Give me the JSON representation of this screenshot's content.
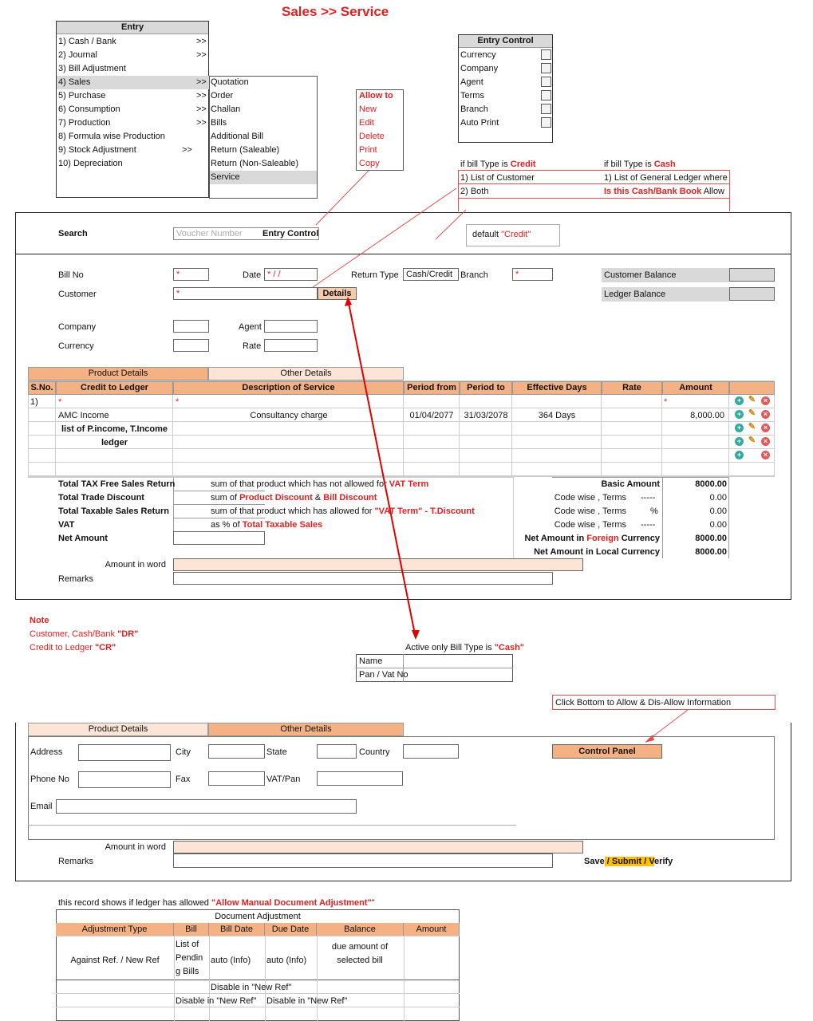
{
  "page_title": "Sales >> Service",
  "entry_menu": {
    "title": "Entry",
    "items": [
      {
        "label": "1) Cash / Bank",
        "arrow": ">>"
      },
      {
        "label": "2) Journal",
        "arrow": ">>"
      },
      {
        "label": "3) Bill Adjustment",
        "arrow": ""
      },
      {
        "label": "4) Sales",
        "arrow": ">>"
      },
      {
        "label": "5) Purchase",
        "arrow": ">>"
      },
      {
        "label": "6) Consumption",
        "arrow": ">>"
      },
      {
        "label": "7) Production",
        "arrow": ">>"
      },
      {
        "label": "8) Formula wise Production",
        "arrow": ""
      },
      {
        "label": "9) Stock Adjustment",
        "arrow": ">>"
      },
      {
        "label": "10) Depreciation",
        "arrow": ""
      }
    ],
    "submenu": [
      "Quotation",
      "Order",
      "Challan",
      "Bills",
      "Additional Bill",
      "Return (Saleable)",
      "Return (Non-Saleable)",
      "Service"
    ]
  },
  "allow_to": {
    "title": "Allow to",
    "items": [
      "New",
      "Edit",
      "Delete",
      "Print",
      "Copy"
    ]
  },
  "entry_control": {
    "title": "Entry Control",
    "items": [
      "Currency",
      "Company",
      "Agent",
      "Terms",
      "Branch",
      "Auto Print"
    ]
  },
  "bill_type_note": {
    "credit_prefix": "if bill Type is ",
    "credit_word": "Credit",
    "credit_items": [
      "1) List of Customer",
      "2) Both"
    ],
    "cash_prefix": "if bill Type is ",
    "cash_word": "Cash",
    "cash_line1": "1) List of General Ledger where",
    "cash_line2_red": "Is this Cash/Bank Book",
    "cash_line2_black": " Allow",
    "default_prefix": "default ",
    "default_value": "\"Credit\""
  },
  "search": {
    "label": "Search",
    "placeholder": "Voucher Number",
    "entry_control": "Entry Control"
  },
  "form": {
    "bill_no": "Bill No",
    "required": "*",
    "date": "Date",
    "date_value": "*  /  /",
    "return_type": "Return Type",
    "return_value": "Cash/Credit",
    "branch": "Branch",
    "customer": "Customer",
    "details": "Details",
    "customer_balance": "Customer Balance",
    "ledger_balance": "Ledger Balance",
    "company": "Company",
    "agent": "Agent",
    "currency": "Currency",
    "rate": "Rate"
  },
  "tabs": {
    "product": "Product Details",
    "other": "Other Details"
  },
  "table": {
    "headers": [
      "S.No.",
      "Credit to Ledger",
      "Description of Service",
      "Period from",
      "Period to",
      "Effective Days",
      "Rate",
      "Amount"
    ],
    "row1": {
      "sno": "1)",
      "ledger": "*",
      "desc": "*",
      "amount": "*"
    },
    "row2": {
      "ledger": "AMC Income",
      "desc": "Consultancy charge",
      "from": "01/04/2077",
      "to": "31/03/2078",
      "days": "364 Days",
      "amount": "8,000.00"
    },
    "row3_line1": "list of P.income, T.Income",
    "row3_line2": "ledger"
  },
  "totals": {
    "tax_free": "Total TAX Free Sales Return",
    "tax_free_note_a": "sum of that product which has not allowed for ",
    "tax_free_note_b": "VAT Term",
    "trade_disc": "Total Trade Discount",
    "trade_note_a": "sum of ",
    "trade_note_b": "Product Discount",
    "trade_note_c": " & ",
    "trade_note_d": "Bill Discount",
    "taxable": "Total Taxable Sales Return",
    "taxable_note_a": "sum of that product which has allowed for ",
    "taxable_note_b": "\"VAT Term\" - T.Discount",
    "vat": "VAT",
    "vat_note_a": "as % of ",
    "vat_note_b": "Total Taxable Sales",
    "net": "Net Amount"
  },
  "summary": {
    "basic": "Basic Amount",
    "basic_val": "8000.00",
    "terms": [
      {
        "label": "Code wise , Terms",
        "sym": "-----",
        "val": "0.00"
      },
      {
        "label": "Code wise , Terms",
        "sym": "%",
        "val": "0.00"
      },
      {
        "label": "Code wise , Terms",
        "sym": "-----",
        "val": "0.00"
      }
    ],
    "net_foreign": "Net Amount in Foreign Currency",
    "net_foreign_val": "8000.00",
    "net_local": "Net Amount in Local Currency",
    "net_local_val": "8000.00"
  },
  "amount_in_word": "Amount in word",
  "remarks": "Remarks",
  "note": {
    "title": "Note",
    "line1_a": "Customer, Cash/Bank  ",
    "line1_b": "\"DR\"",
    "line2_a": "Credit to Ledger  ",
    "line2_b": "\"CR\""
  },
  "cash_only": {
    "prefix": "Active only Bill Type is ",
    "word": "\"Cash\"",
    "fields": [
      "Name",
      "Pan / Vat No"
    ]
  },
  "click_note": "Click Bottom to Allow & Dis-Allow Information",
  "other_details": {
    "address": "Address",
    "city": "City",
    "state": "State",
    "country": "Country",
    "phone": "Phone No",
    "fax": "Fax",
    "vatpan": "VAT/Pan",
    "email": "Email",
    "control_panel": "Control Panel",
    "save_a": "Save",
    "save_b": " / Submit / V",
    "save_c": "erify"
  },
  "doc_adj": {
    "intro_a": "this record shows if ledger has allowed ",
    "intro_b": "\"Allow Manual Document Adjustment\"",
    "intro_c": "\"",
    "title": "Document Adjustment",
    "headers": [
      "Adjustment Type",
      "Bill",
      "Bill Date",
      "Due Date",
      "Balance",
      "Amount"
    ],
    "row_type": "Against Ref. / New Ref",
    "bill_lines": [
      "List of",
      "Pendin",
      "g Bills"
    ],
    "bill_date": "auto (Info)",
    "due_date": "auto (Info)",
    "balance_lines": [
      "due amount of",
      "selected bill"
    ],
    "disable1": "Disable in \"New Ref\"",
    "disable2": "Disable in \"New Ref\"",
    "disable3": "Disable in \"New Ref\""
  }
}
